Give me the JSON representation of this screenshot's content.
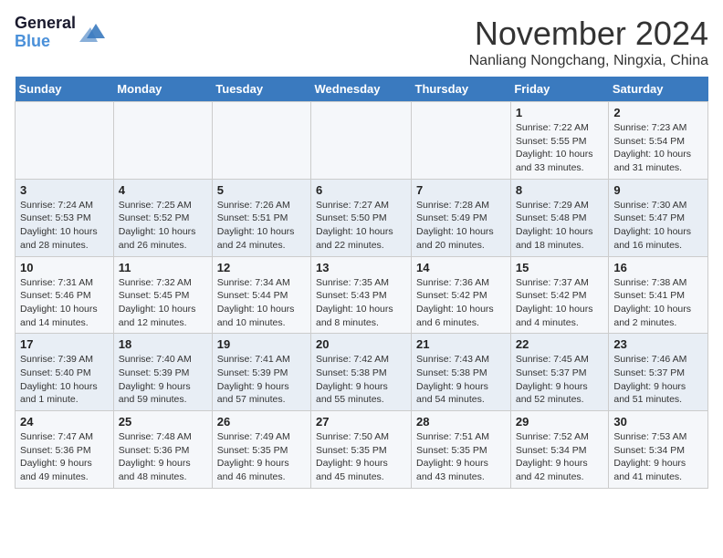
{
  "logo": {
    "line1": "General",
    "line2": "Blue"
  },
  "title": "November 2024",
  "location": "Nanliang Nongchang, Ningxia, China",
  "weekdays": [
    "Sunday",
    "Monday",
    "Tuesday",
    "Wednesday",
    "Thursday",
    "Friday",
    "Saturday"
  ],
  "weeks": [
    [
      {
        "day": "",
        "info": ""
      },
      {
        "day": "",
        "info": ""
      },
      {
        "day": "",
        "info": ""
      },
      {
        "day": "",
        "info": ""
      },
      {
        "day": "",
        "info": ""
      },
      {
        "day": "1",
        "info": "Sunrise: 7:22 AM\nSunset: 5:55 PM\nDaylight: 10 hours and 33 minutes."
      },
      {
        "day": "2",
        "info": "Sunrise: 7:23 AM\nSunset: 5:54 PM\nDaylight: 10 hours and 31 minutes."
      }
    ],
    [
      {
        "day": "3",
        "info": "Sunrise: 7:24 AM\nSunset: 5:53 PM\nDaylight: 10 hours and 28 minutes."
      },
      {
        "day": "4",
        "info": "Sunrise: 7:25 AM\nSunset: 5:52 PM\nDaylight: 10 hours and 26 minutes."
      },
      {
        "day": "5",
        "info": "Sunrise: 7:26 AM\nSunset: 5:51 PM\nDaylight: 10 hours and 24 minutes."
      },
      {
        "day": "6",
        "info": "Sunrise: 7:27 AM\nSunset: 5:50 PM\nDaylight: 10 hours and 22 minutes."
      },
      {
        "day": "7",
        "info": "Sunrise: 7:28 AM\nSunset: 5:49 PM\nDaylight: 10 hours and 20 minutes."
      },
      {
        "day": "8",
        "info": "Sunrise: 7:29 AM\nSunset: 5:48 PM\nDaylight: 10 hours and 18 minutes."
      },
      {
        "day": "9",
        "info": "Sunrise: 7:30 AM\nSunset: 5:47 PM\nDaylight: 10 hours and 16 minutes."
      }
    ],
    [
      {
        "day": "10",
        "info": "Sunrise: 7:31 AM\nSunset: 5:46 PM\nDaylight: 10 hours and 14 minutes."
      },
      {
        "day": "11",
        "info": "Sunrise: 7:32 AM\nSunset: 5:45 PM\nDaylight: 10 hours and 12 minutes."
      },
      {
        "day": "12",
        "info": "Sunrise: 7:34 AM\nSunset: 5:44 PM\nDaylight: 10 hours and 10 minutes."
      },
      {
        "day": "13",
        "info": "Sunrise: 7:35 AM\nSunset: 5:43 PM\nDaylight: 10 hours and 8 minutes."
      },
      {
        "day": "14",
        "info": "Sunrise: 7:36 AM\nSunset: 5:42 PM\nDaylight: 10 hours and 6 minutes."
      },
      {
        "day": "15",
        "info": "Sunrise: 7:37 AM\nSunset: 5:42 PM\nDaylight: 10 hours and 4 minutes."
      },
      {
        "day": "16",
        "info": "Sunrise: 7:38 AM\nSunset: 5:41 PM\nDaylight: 10 hours and 2 minutes."
      }
    ],
    [
      {
        "day": "17",
        "info": "Sunrise: 7:39 AM\nSunset: 5:40 PM\nDaylight: 10 hours and 1 minute."
      },
      {
        "day": "18",
        "info": "Sunrise: 7:40 AM\nSunset: 5:39 PM\nDaylight: 9 hours and 59 minutes."
      },
      {
        "day": "19",
        "info": "Sunrise: 7:41 AM\nSunset: 5:39 PM\nDaylight: 9 hours and 57 minutes."
      },
      {
        "day": "20",
        "info": "Sunrise: 7:42 AM\nSunset: 5:38 PM\nDaylight: 9 hours and 55 minutes."
      },
      {
        "day": "21",
        "info": "Sunrise: 7:43 AM\nSunset: 5:38 PM\nDaylight: 9 hours and 54 minutes."
      },
      {
        "day": "22",
        "info": "Sunrise: 7:45 AM\nSunset: 5:37 PM\nDaylight: 9 hours and 52 minutes."
      },
      {
        "day": "23",
        "info": "Sunrise: 7:46 AM\nSunset: 5:37 PM\nDaylight: 9 hours and 51 minutes."
      }
    ],
    [
      {
        "day": "24",
        "info": "Sunrise: 7:47 AM\nSunset: 5:36 PM\nDaylight: 9 hours and 49 minutes."
      },
      {
        "day": "25",
        "info": "Sunrise: 7:48 AM\nSunset: 5:36 PM\nDaylight: 9 hours and 48 minutes."
      },
      {
        "day": "26",
        "info": "Sunrise: 7:49 AM\nSunset: 5:35 PM\nDaylight: 9 hours and 46 minutes."
      },
      {
        "day": "27",
        "info": "Sunrise: 7:50 AM\nSunset: 5:35 PM\nDaylight: 9 hours and 45 minutes."
      },
      {
        "day": "28",
        "info": "Sunrise: 7:51 AM\nSunset: 5:35 PM\nDaylight: 9 hours and 43 minutes."
      },
      {
        "day": "29",
        "info": "Sunrise: 7:52 AM\nSunset: 5:34 PM\nDaylight: 9 hours and 42 minutes."
      },
      {
        "day": "30",
        "info": "Sunrise: 7:53 AM\nSunset: 5:34 PM\nDaylight: 9 hours and 41 minutes."
      }
    ]
  ]
}
